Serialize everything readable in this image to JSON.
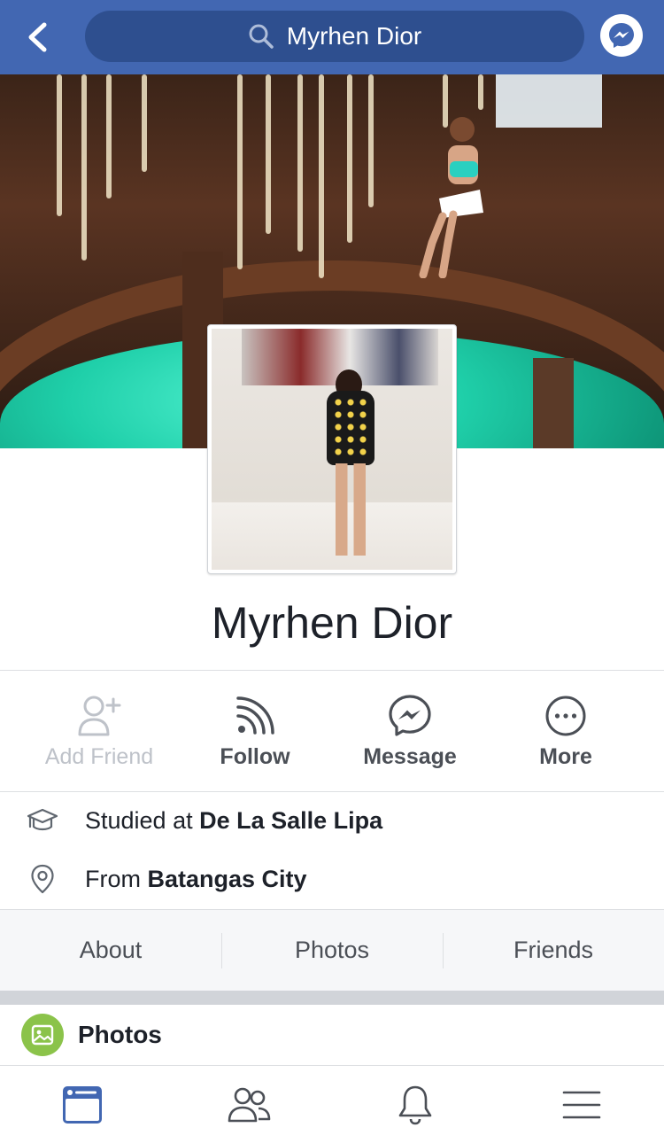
{
  "header": {
    "search_value": "Myrhen Dior",
    "icons": [
      "back-arrow-icon",
      "search-icon",
      "messenger-icon"
    ],
    "bar_color": "#4267b2"
  },
  "profile": {
    "name": "Myrhen Dior"
  },
  "actions": {
    "add_friend": "Add Friend",
    "follow": "Follow",
    "message": "Message",
    "more": "More"
  },
  "info": {
    "education_prefix": "Studied at ",
    "education_place": "De La Salle Lipa",
    "hometown_prefix": "From ",
    "hometown_place": "Batangas City"
  },
  "tabs": [
    "About",
    "Photos",
    "Friends"
  ],
  "photos_section": {
    "title": "Photos"
  },
  "bottom_nav": {
    "icons": [
      "news-feed-icon",
      "friends-icon",
      "notifications-icon",
      "menu-icon"
    ],
    "active": "news-feed-icon",
    "active_color": "#4267b2"
  }
}
